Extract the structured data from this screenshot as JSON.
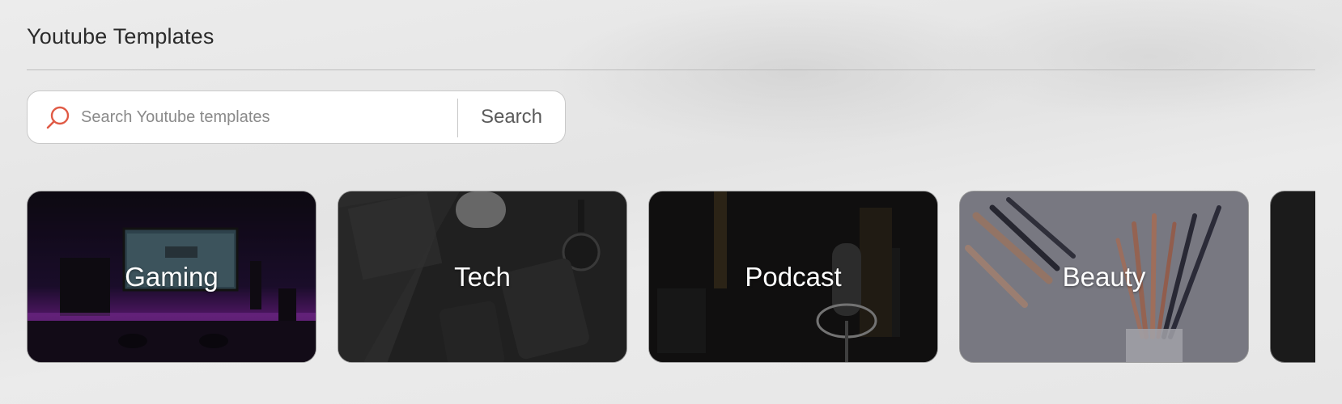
{
  "header": {
    "title": "Youtube Templates"
  },
  "search": {
    "placeholder": "Search Youtube templates",
    "value": "",
    "button_label": "Search",
    "icon": "search-icon",
    "icon_color": "#e05a45"
  },
  "categories": [
    {
      "label": "Gaming",
      "icon": "gaming-setup-image"
    },
    {
      "label": "Tech",
      "icon": "laptop-desk-image"
    },
    {
      "label": "Podcast",
      "icon": "microphone-image"
    },
    {
      "label": "Beauty",
      "icon": "makeup-brushes-image"
    }
  ]
}
